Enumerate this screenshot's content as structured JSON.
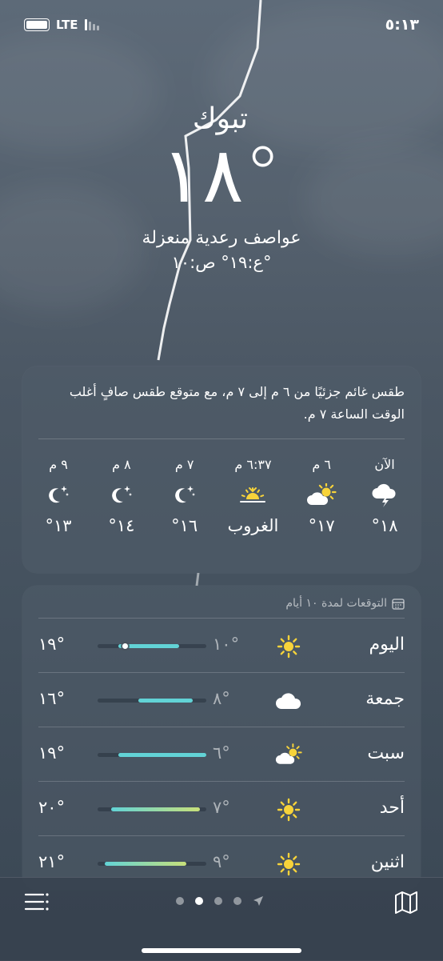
{
  "status_bar": {
    "time": "٥:١٣",
    "network": "LTE"
  },
  "header": {
    "city": "تبوك",
    "temperature": "١٨°",
    "condition": "عواصف رعدية منعزلة",
    "high_low": "ع:١٩°  ص:١٠°"
  },
  "hourly": {
    "summary": "طقس غائم جزئيًا من ٦ م إلى ٧ م، مع متوقع طقس صافٍ أغلب الوقت الساعة ٧ م.",
    "items": [
      {
        "label": "الآن",
        "icon": "thunderstorm-icon",
        "value": "١٨°"
      },
      {
        "label": "٦ م",
        "icon": "partly-cloudy-icon",
        "value": "١٧°"
      },
      {
        "label": "٦:٣٧ م",
        "icon": "sunset-icon",
        "value": "الغروب"
      },
      {
        "label": "٧ م",
        "icon": "moon-stars-icon",
        "value": "١٦°"
      },
      {
        "label": "٨ م",
        "icon": "moon-stars-icon",
        "value": "١٤°"
      },
      {
        "label": "٩ م",
        "icon": "moon-stars-icon",
        "value": "١٣°"
      }
    ]
  },
  "forecast": {
    "title": "التوقعات لمدة ١٠ أيام",
    "scale_min": 6,
    "scale_max": 22,
    "days": [
      {
        "day": "اليوم",
        "icon": "sun-icon",
        "low": "١٠°",
        "high": "١٩°",
        "low_n": 10,
        "high_n": 19,
        "current_n": 18
      },
      {
        "day": "جمعة",
        "icon": "cloud-icon",
        "low": "٨°",
        "high": "١٦°",
        "low_n": 8,
        "high_n": 16
      },
      {
        "day": "سبت",
        "icon": "partly-cloudy-icon",
        "low": "٦°",
        "high": "١٩°",
        "low_n": 6,
        "high_n": 19
      },
      {
        "day": "أحد",
        "icon": "sun-icon",
        "low": "٧°",
        "high": "٢٠°",
        "low_n": 7,
        "high_n": 20
      },
      {
        "day": "اثنين",
        "icon": "sun-icon",
        "low": "٩°",
        "high": "٢١°",
        "low_n": 9,
        "high_n": 21
      }
    ]
  },
  "pager": {
    "page_count": 4,
    "active_page": 1
  },
  "colors": {
    "sun": "#f7d33a",
    "bar_cool": "#62d3d6",
    "bar_warm": "#c8e07a"
  }
}
